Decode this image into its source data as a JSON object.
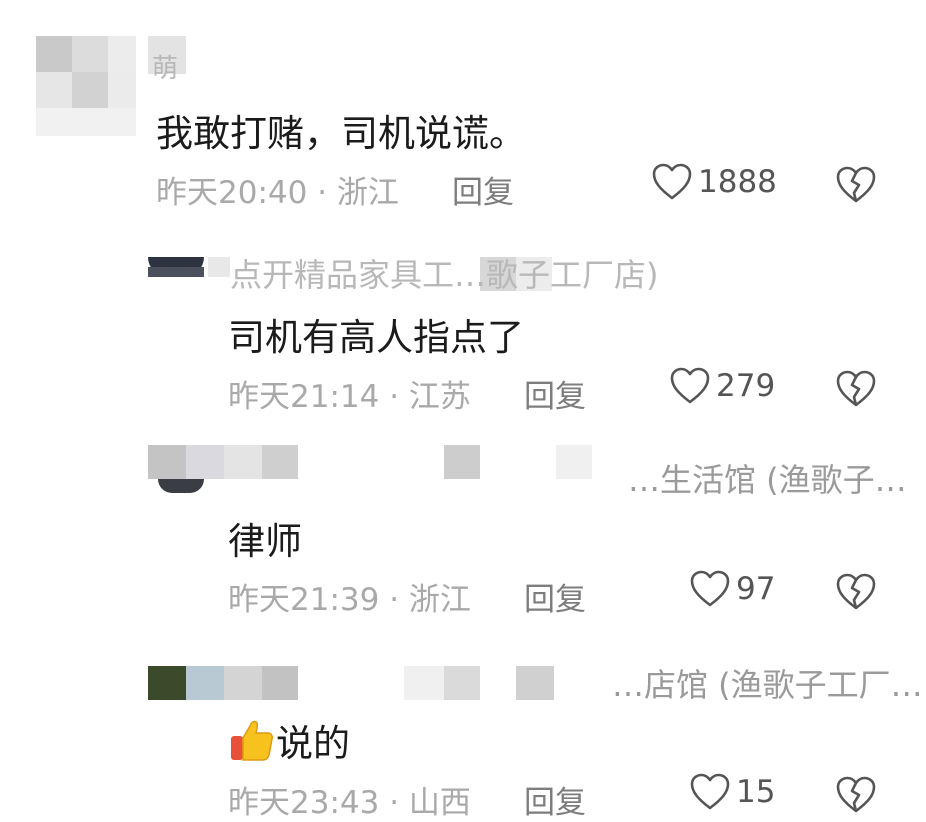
{
  "comments": [
    {
      "author": "萌",
      "text": "我敢打赌，司机说谎。",
      "time_location": "昨天20:40 · 浙江",
      "reply_label": "回复",
      "likes": "1888"
    },
    {
      "author": "点开精品家具工…歌子工厂店)",
      "text": "司机有高人指点了",
      "time_location": "昨天21:14 · 江苏",
      "reply_label": "回复",
      "likes": "279"
    },
    {
      "author": "…生活馆 (渔歌子…",
      "text": "律师",
      "time_location": "昨天21:39 · 浙江",
      "reply_label": "回复",
      "likes": "97"
    },
    {
      "author": "…店馆 (渔歌子工厂…",
      "text": "说的",
      "time_location": "昨天23:43 · 山西",
      "reply_label": "回复",
      "likes": "15"
    }
  ],
  "icons": {
    "like": "heart-outline-icon",
    "dislike": "broken-heart-icon",
    "emoji": "thumbs-up-emoji"
  },
  "colors": {
    "text": "#1b1b1b",
    "meta": "#a9a9a9",
    "reply": "#7d7d7d"
  }
}
